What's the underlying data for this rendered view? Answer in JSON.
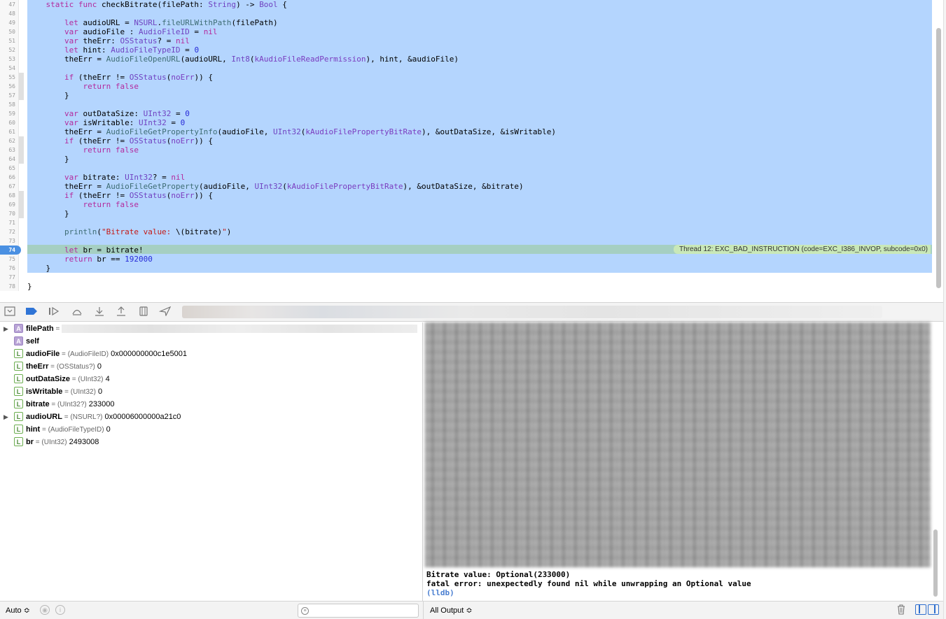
{
  "editor": {
    "lines": [
      {
        "n": "47",
        "segs": [
          [
            "",
            "    "
          ],
          [
            "kw",
            "static func"
          ],
          [
            "",
            " checkBitrate(filePath: "
          ],
          [
            "ty",
            "String"
          ],
          [
            "",
            ") -> "
          ],
          [
            "ty",
            "Bool"
          ],
          [
            "",
            " {"
          ]
        ]
      },
      {
        "n": "48",
        "segs": []
      },
      {
        "n": "49",
        "segs": [
          [
            "",
            "        "
          ],
          [
            "kw",
            "let"
          ],
          [
            "",
            " audioURL = "
          ],
          [
            "ty",
            "NSURL"
          ],
          [
            "",
            "."
          ],
          [
            "fn",
            "fileURLWithPath"
          ],
          [
            "",
            "(filePath)"
          ]
        ]
      },
      {
        "n": "50",
        "segs": [
          [
            "",
            "        "
          ],
          [
            "kw",
            "var"
          ],
          [
            "",
            " audioFile : "
          ],
          [
            "ty",
            "AudioFileID"
          ],
          [
            "",
            " = "
          ],
          [
            "kw",
            "nil"
          ]
        ]
      },
      {
        "n": "51",
        "segs": [
          [
            "",
            "        "
          ],
          [
            "kw",
            "var"
          ],
          [
            "",
            " theErr: "
          ],
          [
            "ty",
            "OSStatus"
          ],
          [
            "",
            "? = "
          ],
          [
            "kw",
            "nil"
          ]
        ]
      },
      {
        "n": "52",
        "segs": [
          [
            "",
            "        "
          ],
          [
            "kw",
            "let"
          ],
          [
            "",
            " hint: "
          ],
          [
            "ty",
            "AudioFileTypeID"
          ],
          [
            "",
            " = "
          ],
          [
            "num",
            "0"
          ]
        ]
      },
      {
        "n": "53",
        "segs": [
          [
            "",
            "        theErr = "
          ],
          [
            "fn",
            "AudioFileOpenURL"
          ],
          [
            "",
            "(audioURL, "
          ],
          [
            "ty",
            "Int8"
          ],
          [
            "",
            "("
          ],
          [
            "ty2",
            "kAudioFileReadPermission"
          ],
          [
            "",
            "), hint, &audioFile)"
          ]
        ]
      },
      {
        "n": "54",
        "segs": []
      },
      {
        "n": "55",
        "segs": [
          [
            "",
            "        "
          ],
          [
            "kw",
            "if"
          ],
          [
            "",
            " (theErr != "
          ],
          [
            "ty",
            "OSStatus"
          ],
          [
            "",
            "("
          ],
          [
            "ty2",
            "noErr"
          ],
          [
            "",
            ")) {"
          ]
        ]
      },
      {
        "n": "56",
        "segs": [
          [
            "",
            "            "
          ],
          [
            "kw",
            "return false"
          ]
        ]
      },
      {
        "n": "57",
        "segs": [
          [
            "",
            "        }"
          ]
        ]
      },
      {
        "n": "58",
        "segs": []
      },
      {
        "n": "59",
        "segs": [
          [
            "",
            "        "
          ],
          [
            "kw",
            "var"
          ],
          [
            "",
            " outDataSize: "
          ],
          [
            "ty",
            "UInt32"
          ],
          [
            "",
            " = "
          ],
          [
            "num",
            "0"
          ]
        ]
      },
      {
        "n": "60",
        "segs": [
          [
            "",
            "        "
          ],
          [
            "kw",
            "var"
          ],
          [
            "",
            " isWritable: "
          ],
          [
            "ty",
            "UInt32"
          ],
          [
            "",
            " = "
          ],
          [
            "num",
            "0"
          ]
        ]
      },
      {
        "n": "61",
        "segs": [
          [
            "",
            "        theErr = "
          ],
          [
            "fn",
            "AudioFileGetPropertyInfo"
          ],
          [
            "",
            "(audioFile, "
          ],
          [
            "ty",
            "UInt32"
          ],
          [
            "",
            "("
          ],
          [
            "ty2",
            "kAudioFilePropertyBitRate"
          ],
          [
            "",
            "), &outDataSize, &isWritable)"
          ]
        ]
      },
      {
        "n": "62",
        "segs": [
          [
            "",
            "        "
          ],
          [
            "kw",
            "if"
          ],
          [
            "",
            " (theErr != "
          ],
          [
            "ty",
            "OSStatus"
          ],
          [
            "",
            "("
          ],
          [
            "ty2",
            "noErr"
          ],
          [
            "",
            ")) {"
          ]
        ]
      },
      {
        "n": "63",
        "segs": [
          [
            "",
            "            "
          ],
          [
            "kw",
            "return false"
          ]
        ]
      },
      {
        "n": "64",
        "segs": [
          [
            "",
            "        }"
          ]
        ]
      },
      {
        "n": "65",
        "segs": []
      },
      {
        "n": "66",
        "segs": [
          [
            "",
            "        "
          ],
          [
            "kw",
            "var"
          ],
          [
            "",
            " bitrate: "
          ],
          [
            "ty",
            "UInt32"
          ],
          [
            "",
            "? = "
          ],
          [
            "kw",
            "nil"
          ]
        ]
      },
      {
        "n": "67",
        "segs": [
          [
            "",
            "        theErr = "
          ],
          [
            "fn",
            "AudioFileGetProperty"
          ],
          [
            "",
            "(audioFile, "
          ],
          [
            "ty",
            "UInt32"
          ],
          [
            "",
            "("
          ],
          [
            "ty2",
            "kAudioFilePropertyBitRate"
          ],
          [
            "",
            "), &outDataSize, &bitrate)"
          ]
        ]
      },
      {
        "n": "68",
        "segs": [
          [
            "",
            "        "
          ],
          [
            "kw",
            "if"
          ],
          [
            "",
            " (theErr != "
          ],
          [
            "ty",
            "OSStatus"
          ],
          [
            "",
            "("
          ],
          [
            "ty2",
            "noErr"
          ],
          [
            "",
            ")) {"
          ]
        ]
      },
      {
        "n": "69",
        "segs": [
          [
            "",
            "            "
          ],
          [
            "kw",
            "return false"
          ]
        ]
      },
      {
        "n": "70",
        "segs": [
          [
            "",
            "        }"
          ]
        ]
      },
      {
        "n": "71",
        "segs": []
      },
      {
        "n": "72",
        "segs": [
          [
            "",
            "        "
          ],
          [
            "fn",
            "println"
          ],
          [
            "",
            "("
          ],
          [
            "str",
            "\"Bitrate value: "
          ],
          [
            "",
            "\\("
          ],
          [
            "",
            "bitrate"
          ],
          [
            "",
            ")"
          ],
          [
            "str",
            "\""
          ],
          [
            "",
            ")"
          ]
        ]
      },
      {
        "n": "73",
        "segs": []
      },
      {
        "n": "74",
        "segs": [
          [
            "",
            "        "
          ],
          [
            "kw",
            "let"
          ],
          [
            "",
            " br = bitrate!"
          ]
        ]
      },
      {
        "n": "75",
        "segs": [
          [
            "",
            "        "
          ],
          [
            "kw",
            "return"
          ],
          [
            "",
            " br == "
          ],
          [
            "num",
            "192000"
          ]
        ]
      },
      {
        "n": "76",
        "segs": [
          [
            "",
            "    }"
          ]
        ]
      },
      {
        "n": "77",
        "segs": []
      },
      {
        "n": "78",
        "segs": [
          [
            "",
            "}"
          ]
        ]
      }
    ],
    "current_line": "74",
    "error_banner": "Thread 12: EXC_BAD_INSTRUCTION (code=EXC_I386_INVOP, subcode=0x0)"
  },
  "variables": [
    {
      "kind": "A",
      "expandable": true,
      "name": "filePath",
      "type": "",
      "value": "",
      "blurred": true
    },
    {
      "kind": "A",
      "expandable": false,
      "name": "self",
      "type": "",
      "value": ""
    },
    {
      "kind": "L",
      "expandable": false,
      "name": "audioFile",
      "type": "(AudioFileID)",
      "value": "0x000000000c1e5001"
    },
    {
      "kind": "L",
      "expandable": false,
      "name": "theErr",
      "type": "(OSStatus?)",
      "value": "0"
    },
    {
      "kind": "L",
      "expandable": false,
      "name": "outDataSize",
      "type": "(UInt32)",
      "value": "4"
    },
    {
      "kind": "L",
      "expandable": false,
      "name": "isWritable",
      "type": "(UInt32)",
      "value": "0"
    },
    {
      "kind": "L",
      "expandable": false,
      "name": "bitrate",
      "type": "(UInt32?)",
      "value": "233000"
    },
    {
      "kind": "L",
      "expandable": true,
      "name": "audioURL",
      "type": "(NSURL?)",
      "value": "0x00006000000a21c0"
    },
    {
      "kind": "L",
      "expandable": false,
      "name": "hint",
      "type": "(AudioFileTypeID)",
      "value": "0"
    },
    {
      "kind": "L",
      "expandable": false,
      "name": "br",
      "type": "(UInt32)",
      "value": "2493008"
    }
  ],
  "console": {
    "lines": [
      "Bitrate value: Optional(233000)",
      "fatal error: unexpectedly found nil while unwrapping an Optional value"
    ],
    "prompt": "(lldb)"
  },
  "bottom_bar": {
    "auto_label": "Auto ≎",
    "output_label": "All Output ≎",
    "filter_placeholder": ""
  },
  "icons": {
    "debug_bar": [
      "hide-debug-area-icon",
      "breakpoints-toggle-icon",
      "continue-icon",
      "step-over-icon",
      "step-into-icon",
      "step-out-icon",
      "view-debugger-icon",
      "simulate-location-icon"
    ],
    "bottom_bar": [
      "eye-icon",
      "info-icon",
      "filter-icon",
      "trash-icon",
      "split-left-icon",
      "split-right-icon"
    ]
  },
  "colors": {
    "selection": "#b4d5fe",
    "current_line": "#a5cfc2",
    "error_banner": "#c9e8b8",
    "keyword": "#b32a9e",
    "type": "#6f42c1",
    "number": "#272ad8",
    "string": "#c41a16",
    "lldb_prompt": "#4a7fd1"
  }
}
